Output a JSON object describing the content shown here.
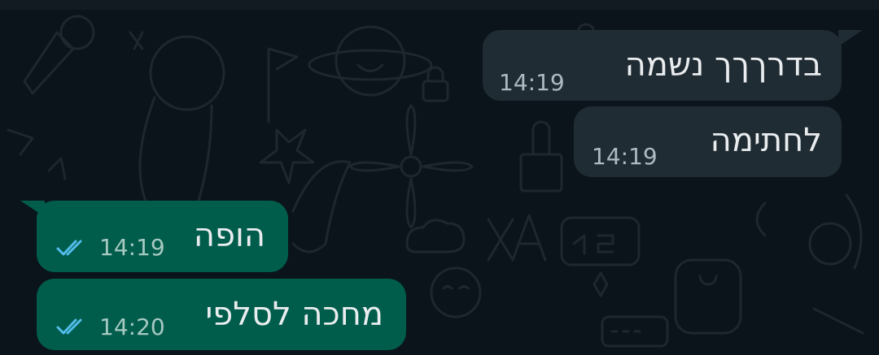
{
  "colors": {
    "chat_background": "#0b141a",
    "incoming_bubble": "#202c33",
    "outgoing_bubble": "#005c4b",
    "message_text": "#e9edef",
    "timestamp": "#aebac1",
    "read_ticks": "#53bdeb"
  },
  "messages": [
    {
      "direction": "incoming",
      "text": "בדרךךך נשמה",
      "time": "14:19"
    },
    {
      "direction": "incoming",
      "text": "לחתימה",
      "time": "14:19"
    },
    {
      "direction": "outgoing",
      "text": "הופה",
      "time": "14:19",
      "status_icon": "double-check-read-icon"
    },
    {
      "direction": "outgoing",
      "text": "מחכה לסלפי",
      "time": "14:20",
      "status_icon": "double-check-read-icon"
    }
  ]
}
